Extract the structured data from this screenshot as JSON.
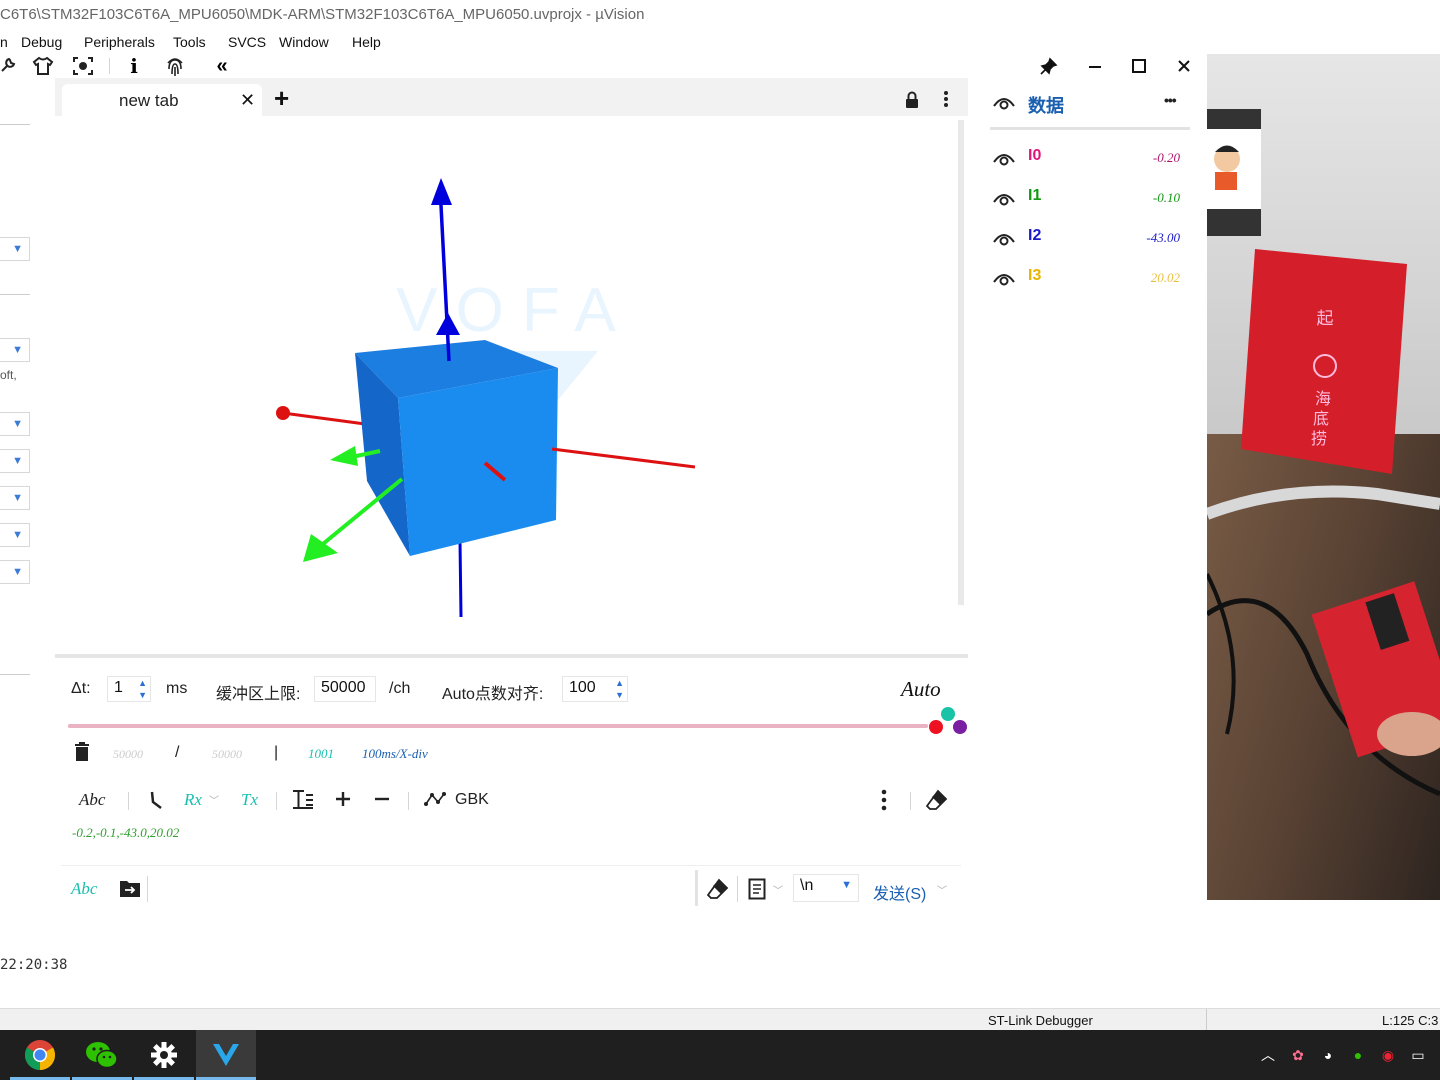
{
  "ide": {
    "title": "C6T6\\STM32F103C6T6A_MPU6050\\MDK-ARM\\STM32F103C6T6A_MPU6050.uvprojx - µVision",
    "menu": [
      "n",
      "Debug",
      "Peripherals",
      "Tools",
      "SVCS",
      "Window",
      "Help"
    ],
    "side_fragment": "oft,",
    "clock": "22:20:38",
    "status_debugger": "ST-Link Debugger",
    "status_pos": "L:125 C:3"
  },
  "window_controls": {
    "pin": "pin-icon",
    "minimize": "minimize-icon",
    "maximize": "maximize-icon",
    "close": "close-icon"
  },
  "tabs": {
    "active_label": "new tab",
    "close_glyph": "✕",
    "add_glyph": "+"
  },
  "plot": {
    "watermark": "VOFA",
    "cube_color": "#1a86ee",
    "axis_colors": {
      "up": "#0000dd",
      "x": "#dd1111",
      "green": "#22ee22"
    }
  },
  "controls": {
    "dt_label": "Δt:",
    "dt_value": "1",
    "dt_unit": "ms",
    "buffer_label": "缓冲区上限:",
    "buffer_value": "50000",
    "buffer_unit": "/ch",
    "align_label": "Auto点数对齐:",
    "align_value": "100",
    "auto_label": "Auto",
    "slider_fraction": 1.0
  },
  "stats": {
    "count_a": "50000",
    "slash": "/",
    "count_b": "50000",
    "bar": "|",
    "points": "1001",
    "xdiv": "100ms/X-div"
  },
  "rx_toolbar": {
    "abc": "Abc",
    "rx": "Rx",
    "tx": "Tx",
    "encoding": "GBK"
  },
  "rx_text": "-0.2,-0.1,-43.0,20.02",
  "send_bar": {
    "abc": "Abc",
    "line_ending": "\\n",
    "send_label": "发送(S)"
  },
  "sidebar": {
    "title": "数据",
    "more": "•••",
    "channels": [
      {
        "name": "I0",
        "value": "-0.20",
        "color": "#e0157a"
      },
      {
        "name": "I1",
        "value": "-0.10",
        "color": "#119911"
      },
      {
        "name": "I2",
        "value": "-43.00",
        "color": "#1a1acc"
      },
      {
        "name": "I3",
        "value": "20.02",
        "color": "#e8b400"
      }
    ]
  },
  "camera": {
    "sign_text": "一起嗨 海底捞"
  }
}
